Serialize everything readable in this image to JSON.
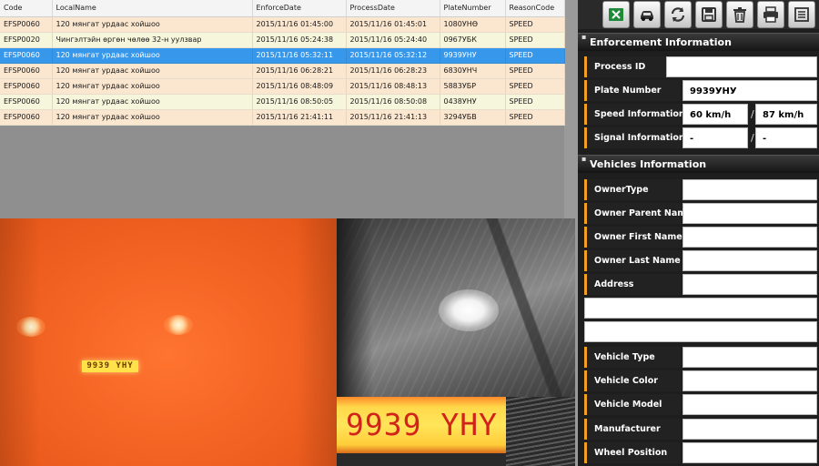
{
  "table": {
    "columns": [
      "Code",
      "LocalName",
      "EnforceDate",
      "ProcessDate",
      "PlateNumber",
      "ReasonCode"
    ],
    "rows": [
      {
        "code": "EFSP0060",
        "local_name": "120 мянгат урдаас хойшоо",
        "enforce_date": "2015/11/16 01:45:00",
        "process_date": "2015/11/16 01:45:01",
        "plate": "1080УНӨ",
        "reason": "SPEED"
      },
      {
        "code": "EFSP0020",
        "local_name": "Чингэлтэйн өргөн чөлөө 32-н уулзвар",
        "enforce_date": "2015/11/16 05:24:38",
        "process_date": "2015/11/16 05:24:40",
        "plate": "0967УБК",
        "reason": "SPEED"
      },
      {
        "code": "EFSP0060",
        "local_name": "120 мянгат урдаас хойшоо",
        "enforce_date": "2015/11/16 05:32:11",
        "process_date": "2015/11/16 05:32:12",
        "plate": "9939УНУ",
        "reason": "SPEED"
      },
      {
        "code": "EFSP0060",
        "local_name": "120 мянгат урдаас хойшоо",
        "enforce_date": "2015/11/16 06:28:21",
        "process_date": "2015/11/16 06:28:23",
        "plate": "6830УНЧ",
        "reason": "SPEED"
      },
      {
        "code": "EFSP0060",
        "local_name": "120 мянгат урдаас хойшоо",
        "enforce_date": "2015/11/16 08:48:09",
        "process_date": "2015/11/16 08:48:13",
        "plate": "5883УБР",
        "reason": "SPEED"
      },
      {
        "code": "EFSP0060",
        "local_name": "120 мянгат урдаас хойшоо",
        "enforce_date": "2015/11/16 08:50:05",
        "process_date": "2015/11/16 08:50:08",
        "plate": "0438УНУ",
        "reason": "SPEED"
      },
      {
        "code": "EFSP0060",
        "local_name": "120 мянгат урдаас хойшоо",
        "enforce_date": "2015/11/16 21:41:11",
        "process_date": "2015/11/16 21:41:13",
        "plate": "3294УБВ",
        "reason": "SPEED"
      }
    ],
    "selected_index": 2
  },
  "camera": {
    "ir_plate_text": "9939 YHY",
    "crop_plate_text": "9939 YHY"
  },
  "toolbar": {
    "icons": [
      "excel-icon",
      "car-icon",
      "refresh-icon",
      "save-icon",
      "trash-icon",
      "printer-icon",
      "list-icon"
    ]
  },
  "enforcement": {
    "title": "Enforcement Information",
    "process_id_label": "Process ID",
    "process_id_value": "",
    "plate_label": "Plate Number",
    "plate_value": "9939УНУ",
    "speed_label": "Speed Information",
    "speed_value": "60 km/h",
    "speed_limit": "87 km/h",
    "signal_label": "Signal Information",
    "signal_value": "-",
    "signal_value2": "-",
    "separator": "/"
  },
  "vehicles": {
    "title": "Vehicles Information",
    "owner_type_label": "OwnerType",
    "owner_parent_label": "Owner Parent Name",
    "owner_first_label": "Owner First Name",
    "owner_last_label": "Owner Last Name",
    "address_label": "Address",
    "vehicle_type_label": "Vehicle Type",
    "vehicle_color_label": "Vehicle Color",
    "vehicle_model_label": "Vehicle Model",
    "manufacturer_label": "Manufacturer",
    "wheel_position_label": "Wheel Position"
  },
  "colors": {
    "accent_orange": "#f2a024",
    "selected_row": "#3797ea",
    "row_odd": "#fbe6cf",
    "row_even": "#f6f6dc"
  }
}
